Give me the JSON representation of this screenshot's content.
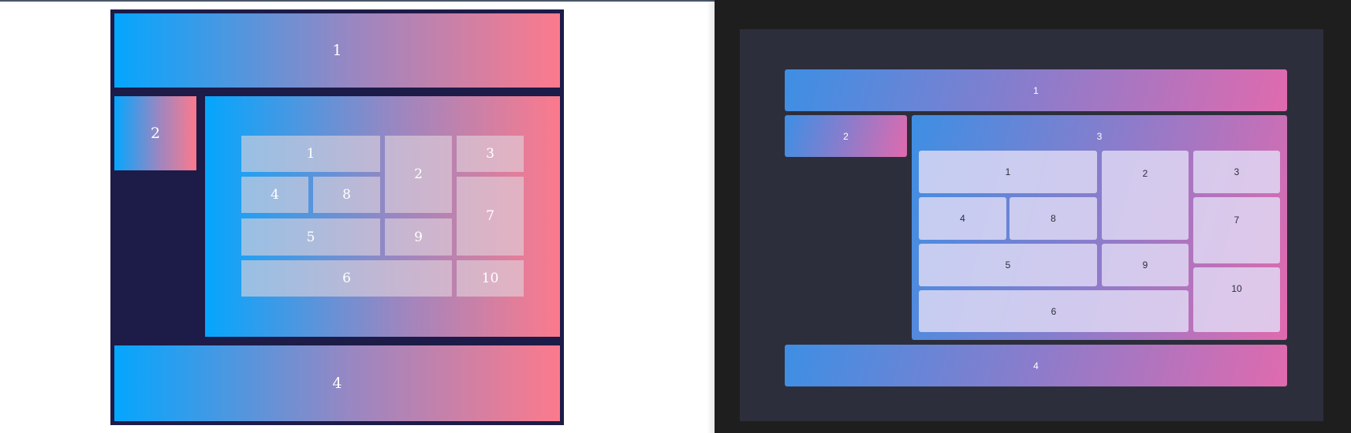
{
  "left": {
    "outer": {
      "header": "1",
      "sidebar": "2",
      "footer": "4"
    },
    "inner": [
      "1",
      "2",
      "3",
      "4",
      "8",
      "7",
      "5",
      "9",
      "6",
      "10"
    ]
  },
  "right": {
    "outer": {
      "header": "1",
      "sidebar": "2",
      "main": "3",
      "footer": "4"
    },
    "inner": [
      "1",
      "2",
      "3",
      "4",
      "8",
      "7",
      "5",
      "9",
      "10",
      "6"
    ]
  },
  "colors": {
    "left_frame": "#1d1b48",
    "gradient_start": "#04a6fe",
    "gradient_end": "#fc7a8c",
    "right_bg": "#2d2e3b",
    "right_gradient_start": "#3d8fe4",
    "right_gradient_end": "#e06aae"
  }
}
